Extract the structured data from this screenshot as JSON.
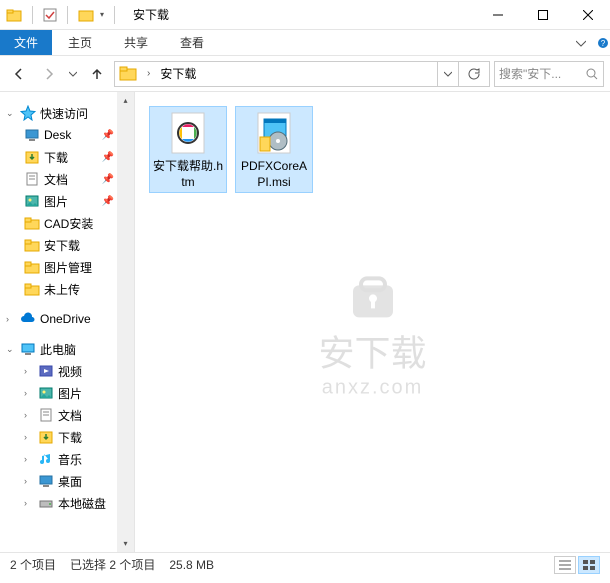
{
  "title": "安下载",
  "ribbon": {
    "file": "文件",
    "tabs": [
      "主页",
      "共享",
      "查看"
    ]
  },
  "breadcrumb": {
    "current": "安下载"
  },
  "search": {
    "placeholder": "搜索\"安下..."
  },
  "nav": {
    "quick_access": "快速访问",
    "items": [
      {
        "label": "Desk",
        "pinned": true,
        "icon": "desktop"
      },
      {
        "label": "下载",
        "pinned": true,
        "icon": "downloads"
      },
      {
        "label": "文档",
        "pinned": true,
        "icon": "documents"
      },
      {
        "label": "图片",
        "pinned": true,
        "icon": "pictures"
      },
      {
        "label": "CAD安装",
        "pinned": false,
        "icon": "folder"
      },
      {
        "label": "安下载",
        "pinned": false,
        "icon": "folder"
      },
      {
        "label": "图片管理",
        "pinned": false,
        "icon": "folder"
      },
      {
        "label": "未上传",
        "pinned": false,
        "icon": "folder"
      }
    ],
    "onedrive": "OneDrive",
    "thispc": "此电脑",
    "pc_items": [
      {
        "label": "视频",
        "icon": "videos"
      },
      {
        "label": "图片",
        "icon": "pictures"
      },
      {
        "label": "文档",
        "icon": "documents"
      },
      {
        "label": "下载",
        "icon": "downloads"
      },
      {
        "label": "音乐",
        "icon": "music"
      },
      {
        "label": "桌面",
        "icon": "desktop"
      },
      {
        "label": "本地磁盘",
        "icon": "drive"
      }
    ]
  },
  "files": [
    {
      "name": "安下载帮助.htm",
      "type": "htm"
    },
    {
      "name": "PDFXCoreAPI.msi",
      "type": "msi"
    }
  ],
  "watermark": {
    "text": "安下载",
    "url": "anxz.com"
  },
  "status": {
    "count": "2 个项目",
    "selected": "已选择 2 个项目",
    "size": "25.8 MB"
  }
}
